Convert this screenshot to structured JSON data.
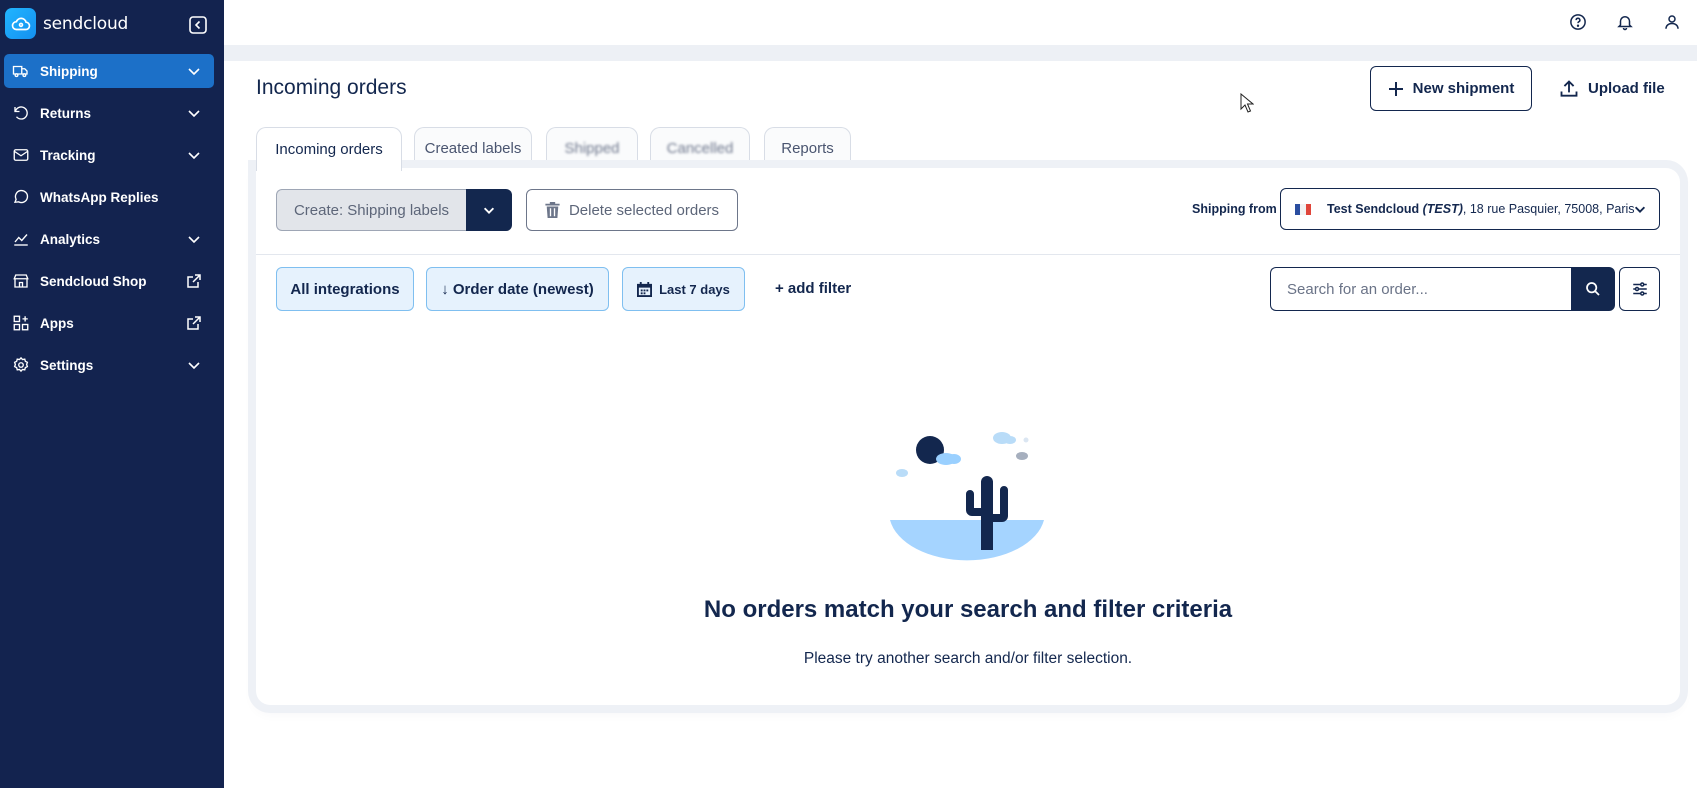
{
  "brand": {
    "name": "sendcloud"
  },
  "sidebar": {
    "items": [
      {
        "label": "Shipping",
        "icon": "truck-icon",
        "right": "chevron-down-icon",
        "active": true
      },
      {
        "label": "Returns",
        "icon": "return-icon",
        "right": "chevron-down-icon"
      },
      {
        "label": "Tracking",
        "icon": "envelope-icon",
        "right": "chevron-down-icon"
      },
      {
        "label": "WhatsApp Replies",
        "icon": "chat-bubble-icon",
        "right": ""
      },
      {
        "label": "Analytics",
        "icon": "chart-icon",
        "right": "chevron-down-icon"
      },
      {
        "label": "Sendcloud Shop",
        "icon": "store-icon",
        "right": "external-link-icon"
      },
      {
        "label": "Apps",
        "icon": "apps-icon",
        "right": "external-link-icon"
      },
      {
        "label": "Settings",
        "icon": "gear-icon",
        "right": "chevron-down-icon"
      }
    ]
  },
  "topbar": {
    "icons": [
      "help-icon",
      "bell-icon",
      "user-icon"
    ]
  },
  "page": {
    "title": "Incoming orders",
    "new_shipment": "New shipment",
    "upload_file": "Upload file"
  },
  "tabs": [
    {
      "label": "Incoming orders",
      "active": true
    },
    {
      "label": "Created labels"
    },
    {
      "label": "Shipped",
      "blurred": true
    },
    {
      "label": "Cancelled",
      "blurred": true
    },
    {
      "label": "Reports"
    }
  ],
  "actions": {
    "create_label": "Create: Shipping labels",
    "delete_label": "Delete selected orders",
    "shipping_from_label": "Shipping from",
    "shipping_from_name": "Test Sendcloud",
    "shipping_from_tag": "(TEST)",
    "shipping_from_address": ", 18 rue Pasquier, 75008, Paris"
  },
  "filters": {
    "integrations": "All integrations",
    "order_date": "↓ Order date (newest)",
    "date_range": "Last 7 days",
    "add_filter": "+ add filter",
    "search_placeholder": "Search for an order..."
  },
  "empty_state": {
    "title": "No orders match your search and filter criteria",
    "subtitle": "Please try another search and/or filter selection."
  },
  "colors": {
    "sidebar_bg": "#13234f",
    "active_item": "#1c70c8",
    "primary": "#13274e",
    "chip_bg": "#e6f2fd",
    "chip_border": "#7fbff0"
  }
}
